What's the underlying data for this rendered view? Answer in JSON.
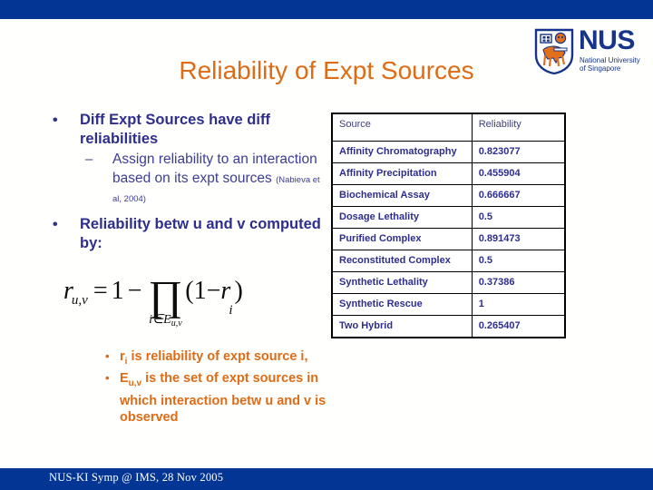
{
  "slide": {
    "title": "Reliability of Expt Sources",
    "title_color": "#DE6B16",
    "bar_color": "#033694",
    "body_color": "#2E2E8E",
    "footer": "NUS-KI Symp @ IMS, 28 Nov 2005"
  },
  "logo": {
    "word": "NUS",
    "sub_line1": "National University",
    "sub_line2": "of Singapore",
    "shield_icon": "nus-shield-crest-icon"
  },
  "bullets": {
    "b1": "Diff Expt Sources have diff reliabilities",
    "b1_sub": "Assign reliability to an interaction based on its expt sources",
    "b1_citation": "(Nabieva et al, 2004)",
    "b2": "Reliability betw u and v computed by:",
    "bullet_glyph": "•",
    "dash_glyph": "–"
  },
  "formula": {
    "lhs_var": "r",
    "lhs_sub": "u,v",
    "equals": "=",
    "one": "1",
    "minus": "−",
    "product_glyph": "∏",
    "product_index": "i∈E",
    "product_index_sub": "u,v",
    "tail_open": "(1−",
    "tail_var": "r",
    "tail_sub": "i",
    "tail_close": ")"
  },
  "orange_notes": [
    {
      "text_pre": "r",
      "sub": "i",
      "text_post": " is reliability of expt source i,"
    },
    {
      "text_pre": "E",
      "sub": "u,v",
      "text_post": " is the set of expt sources in which interaction betw u and v is observed"
    }
  ],
  "table": {
    "headers": [
      "Source",
      "Reliability"
    ],
    "rows": [
      {
        "source": "Affinity Chromatography",
        "reliability": "0.823077"
      },
      {
        "source": "Affinity Precipitation",
        "reliability": "0.455904"
      },
      {
        "source": "Biochemical Assay",
        "reliability": "0.666667"
      },
      {
        "source": "Dosage Lethality",
        "reliability": "0.5"
      },
      {
        "source": "Purified Complex",
        "reliability": "0.891473"
      },
      {
        "source": "Reconstituted Complex",
        "reliability": "0.5"
      },
      {
        "source": "Synthetic Lethality",
        "reliability": "0.37386"
      },
      {
        "source": "Synthetic Rescue",
        "reliability": "1"
      },
      {
        "source": "Two Hybrid",
        "reliability": "0.265407"
      }
    ]
  }
}
